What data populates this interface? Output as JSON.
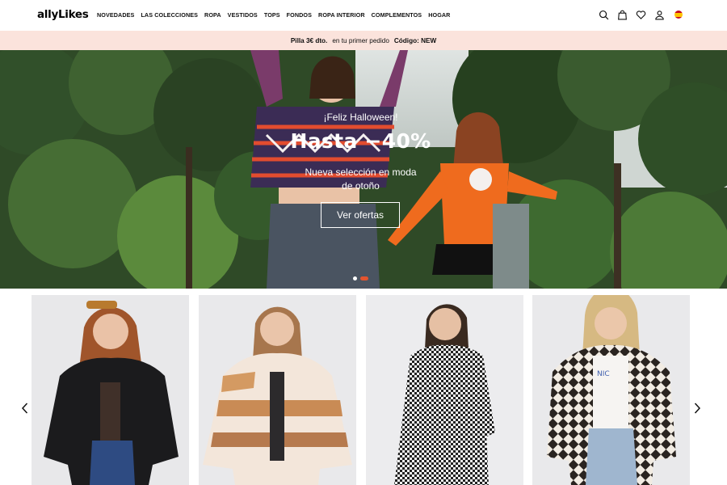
{
  "header": {
    "logo": "allyLikes",
    "nav": [
      "NOVEDADES",
      "LAS COLECCIONES",
      "ROPA",
      "VESTIDOS",
      "TOPS",
      "FONDOS",
      "ROPA INTERIOR",
      "COMPLEMENTOS",
      "HOGAR"
    ],
    "icons": [
      "search-icon",
      "bag-icon",
      "heart-icon",
      "user-icon",
      "spain-flag-icon"
    ]
  },
  "promo": {
    "offer": "Pilla 3€ dto.",
    "middle": "en tu primer pedido",
    "code": "Código: NEW",
    "background": "#fbe3dc"
  },
  "hero": {
    "eyebrow": "¡Feliz Halloween!",
    "title": "Hasta −40%",
    "subtitle": "Nueva selección en moda de otoño",
    "button": "Ver ofertas",
    "slides": 2,
    "active_slide": 2,
    "accent": "#e3542f"
  },
  "carousel": {
    "products": [
      {
        "name": "black-leather-jacket"
      },
      {
        "name": "striped-teddy-jacket"
      },
      {
        "name": "houndstooth-coat"
      },
      {
        "name": "checkered-fleece-jacket"
      }
    ]
  }
}
